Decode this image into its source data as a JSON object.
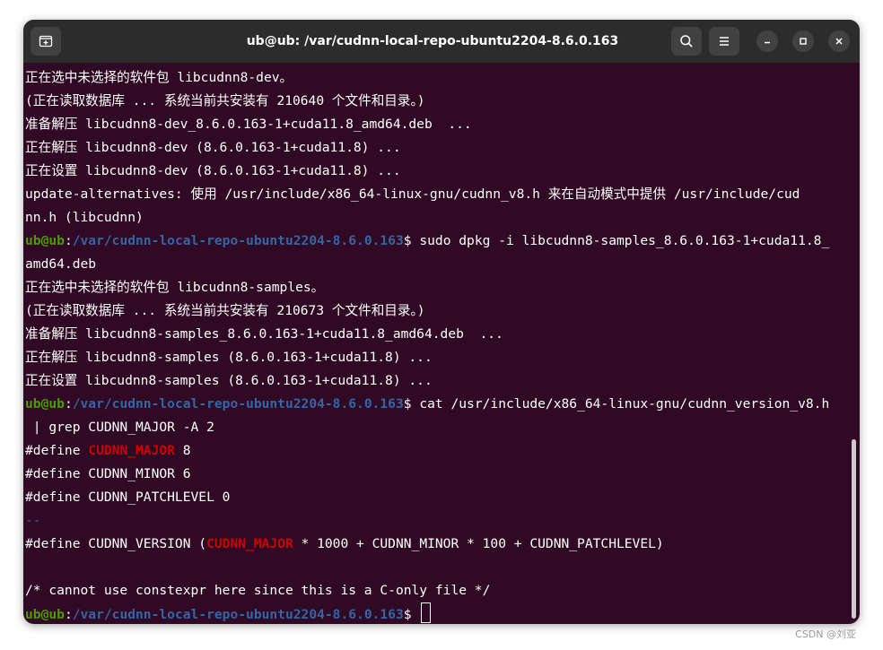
{
  "window": {
    "title": "ub@ub: /var/cudnn-local-repo-ubuntu2204-8.6.0.163"
  },
  "icons": {
    "new_tab": "new-tab-icon",
    "search": "search-icon",
    "menu": "hamburger-menu-icon",
    "minimize": "minimize-icon",
    "maximize": "maximize-icon",
    "close": "close-icon"
  },
  "colors": {
    "terminal_bg": "#300a24",
    "titlebar_bg": "#2c2c2c",
    "prompt_user": "#4e9a06",
    "prompt_path": "#3465a4",
    "grep_match": "#cc0000"
  },
  "prompt": {
    "user": "ub@ub",
    "colon": ":",
    "path": "/var/cudnn-local-repo-ubuntu2204-8.6.0.163",
    "dollar": "$ "
  },
  "terminal": {
    "l1": "正在选中未选择的软件包 libcudnn8-dev。",
    "l2": "(正在读取数据库 ... 系统当前共安装有 210640 个文件和目录。)",
    "l3": "准备解压 libcudnn8-dev_8.6.0.163-1+cuda11.8_amd64.deb  ...",
    "l4": "正在解压 libcudnn8-dev (8.6.0.163-1+cuda11.8) ...",
    "l5": "正在设置 libcudnn8-dev (8.6.0.163-1+cuda11.8) ...",
    "l6": "update-alternatives: 使用 /usr/include/x86_64-linux-gnu/cudnn_v8.h 来在自动模式中提供 /usr/include/cud",
    "l7": "nn.h (libcudnn)",
    "l8_cmd": "sudo dpkg -i libcudnn8-samples_8.6.0.163-1+cuda11.8_",
    "l9": "amd64.deb",
    "l10": "正在选中未选择的软件包 libcudnn8-samples。",
    "l11": "(正在读取数据库 ... 系统当前共安装有 210673 个文件和目录。)",
    "l12": "准备解压 libcudnn8-samples_8.6.0.163-1+cuda11.8_amd64.deb  ...",
    "l13": "正在解压 libcudnn8-samples (8.6.0.163-1+cuda11.8) ...",
    "l14": "正在设置 libcudnn8-samples (8.6.0.163-1+cuda11.8) ...",
    "l15_cmd": "cat /usr/include/x86_64-linux-gnu/cudnn_version_v8.h",
    "l16": " | grep CUDNN_MAJOR -A 2",
    "l17_pre": "#define ",
    "l17_match": "CUDNN_MAJOR",
    "l17_post": " 8",
    "l18": "#define CUDNN_MINOR 6",
    "l19": "#define CUDNN_PATCHLEVEL 0",
    "l20": "--",
    "l21_pre": "#define CUDNN_VERSION (",
    "l21_match": "CUDNN_MAJOR",
    "l21_post": " * 1000 + CUDNN_MINOR * 100 + CUDNN_PATCHLEVEL)",
    "l23": "/* cannot use constexpr here since this is a C-only file */"
  },
  "watermark": "CSDN @刘亚"
}
